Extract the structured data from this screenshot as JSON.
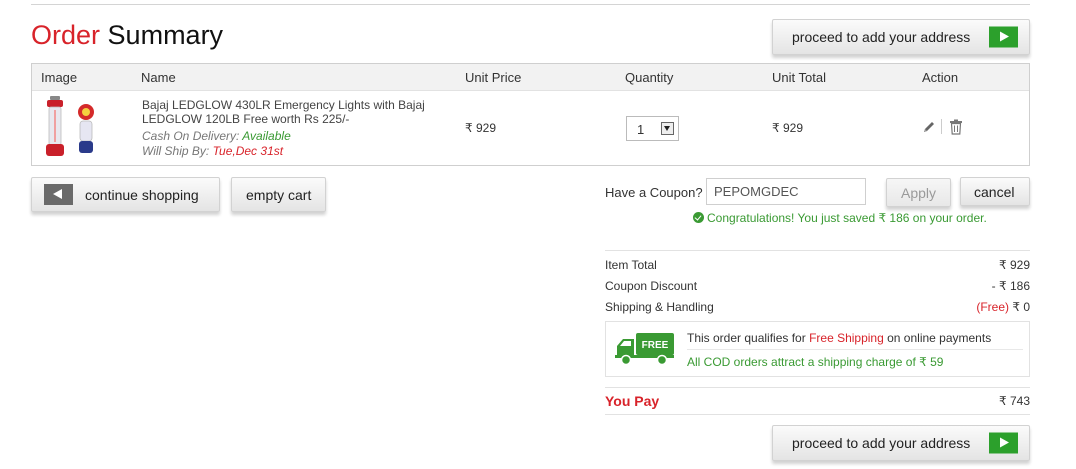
{
  "page": {
    "title_accent": "Order",
    "title_rest": "Summary",
    "proceed_label": "proceed to add your address"
  },
  "table": {
    "headers": {
      "image": "Image",
      "name": "Name",
      "unit_price": "Unit Price",
      "quantity": "Quantity",
      "unit_total": "Unit Total",
      "action": "Action"
    },
    "rows": [
      {
        "name": "Bajaj LEDGLOW 430LR Emergency Lights with Bajaj LEDGLOW 120LB Free worth Rs 225/-",
        "cod_label": "Cash On Delivery:",
        "cod_value": "Available",
        "ship_label": "Will Ship By:",
        "ship_value": "Tue,Dec 31st",
        "unit_price": "₹ 929",
        "quantity": "1",
        "unit_total": "₹ 929"
      }
    ]
  },
  "actions": {
    "continue_label": "continue shopping",
    "empty_cart_label": "empty cart"
  },
  "coupon": {
    "label": "Have a Coupon?",
    "value": "PEPOMGDEC",
    "apply_label": "Apply",
    "cancel_label": "cancel",
    "message": "Congratulations! You just saved ₹  186 on your order."
  },
  "summary": {
    "item_total_label": "Item Total",
    "item_total_value": "₹ 929",
    "discount_label": "Coupon Discount",
    "discount_value": "- ₹ 186",
    "shipping_label": "Shipping & Handling",
    "shipping_free": "(Free)",
    "shipping_value": "₹ 0",
    "free_badge": "FREE",
    "ship_note_pre": "This order qualifies for",
    "ship_note_highlight": "Free Shipping",
    "ship_note_post": "on online payments",
    "cod_note": "All COD orders attract a shipping charge of ₹ 59",
    "you_pay_label": "You Pay",
    "you_pay_value": "₹ 743"
  },
  "colors": {
    "accent_red": "#d8232a",
    "success_green": "#3a9a33",
    "proceed_arrow_green": "#2ca02c"
  },
  "icons": [
    "play-arrow-icon",
    "back-arrow-icon",
    "edit-pencil-icon",
    "trash-icon",
    "dropdown-arrow-icon",
    "check-circle-icon",
    "free-shipping-truck-icon"
  ]
}
